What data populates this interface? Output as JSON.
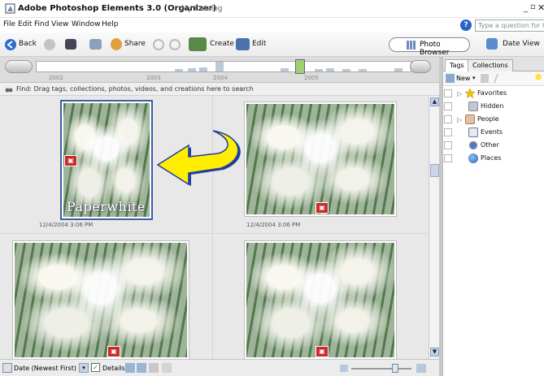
{
  "window": {
    "title": "Adobe Photoshop Elements 3.0 (Organizer)",
    "catalog": "My Catalog",
    "min_glyph": "_",
    "max_glyph": "▫",
    "close_glyph": "✕"
  },
  "menu": [
    "File",
    "Edit",
    "Find",
    "View",
    "Window",
    "Help"
  ],
  "help": {
    "placeholder": "Type a question for help",
    "glyph": "?"
  },
  "toolbar": {
    "back_label": "Back",
    "share_label": "Share",
    "create_label": "Create",
    "edit_label": "Edit",
    "photo_browser_label": "Photo Browser",
    "date_view_label": "Date View"
  },
  "timeline": {
    "years": [
      "2002",
      "2003",
      "2004",
      "2005"
    ]
  },
  "find": {
    "text": "Find: Drag tags, collections, photos, videos, and creations here to search"
  },
  "photos": [
    {
      "date": "12/4/2004 3:06 PM",
      "overlay_text": "Paperwhite",
      "selected": true
    },
    {
      "date": "12/4/2004 3:06 PM",
      "overlay_text": "",
      "selected": false
    },
    {
      "date": "",
      "overlay_text": "",
      "selected": false
    },
    {
      "date": "",
      "overlay_text": "",
      "selected": false
    }
  ],
  "tags_panel": {
    "tabs": [
      "Tags",
      "Collections"
    ],
    "new_label": "New",
    "items": [
      "Favorites",
      "Hidden",
      "People",
      "Events",
      "Other",
      "Places"
    ]
  },
  "statusbar": {
    "sort_label": "Date (Newest First)",
    "details_label": "Details"
  },
  "colors": {
    "selection": "#3b5fa8",
    "arrow_fill": "#ffee00",
    "arrow_shadow": "#1f3fa0",
    "badge": "#c92a2a"
  }
}
